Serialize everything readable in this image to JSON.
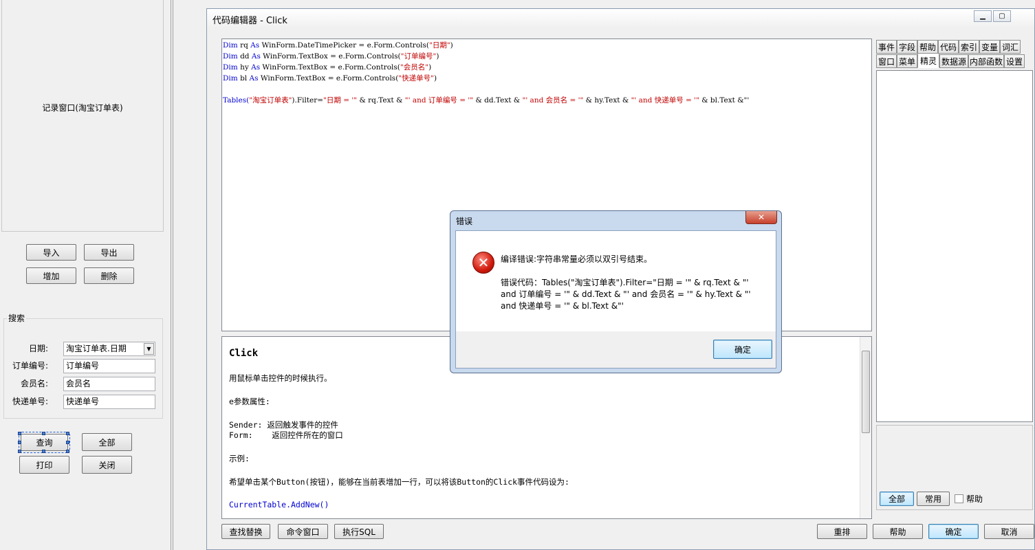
{
  "designer": {
    "record_window_label": "记录窗口(淘宝订单表)",
    "buttons": {
      "import": "导入",
      "export": "导出",
      "add": "增加",
      "delete": "删除",
      "query": "查询",
      "all": "全部",
      "print": "打印",
      "close": "关闭"
    },
    "search_group_label": "搜索",
    "fields": [
      {
        "label": "日期:",
        "value": "淘宝订单表.日期"
      },
      {
        "label": "订单编号:",
        "value": "订单编号"
      },
      {
        "label": "会员名:",
        "value": "会员名"
      },
      {
        "label": "快递单号:",
        "value": "快递单号"
      }
    ]
  },
  "editor": {
    "title": "代码编辑器 - Click",
    "code": {
      "l1": {
        "a": "Dim",
        "b": " rq ",
        "c": "As",
        "d": " WinForm.DateTimePicker = e.Form.Controls(",
        "e": "\"日期\"",
        "f": ")"
      },
      "l2": {
        "a": "Dim",
        "b": " dd ",
        "c": "As",
        "d": " WinForm.TextBox = e.Form.Controls(",
        "e": "\"订单编号\"",
        "f": ")"
      },
      "l3": {
        "a": "Dim",
        "b": " hy ",
        "c": "As",
        "d": " WinForm.TextBox = e.Form.Controls(",
        "e": "\"会员名\"",
        "f": ")"
      },
      "l4": {
        "a": "Dim",
        "b": " bl ",
        "c": "As",
        "d": " WinForm.TextBox = e.Form.Controls(",
        "e": "\"快递单号\"",
        "f": ")"
      },
      "l6": {
        "a": "Tables(",
        "b": "\"淘宝订单表\"",
        "c": ").Filter=",
        "d": "\"日期 = '\"",
        "e": " & rq.Text & ",
        "f": "\"' and 订单编号 = '\"",
        "g": " & dd.Text & ",
        "h": "\"' and 会员名 = '\"",
        "i": " & hy.Text & ",
        "j": "\"' and 快递单号 = '\"",
        "k": " & bl.Text &\"'"
      }
    },
    "help": {
      "title": "Click",
      "lines": [
        "用鼠标单击控件的时候执行。",
        "e参数属性:",
        "Sender: 返回触发事件的控件",
        "Form:    返回控件所在的窗口",
        "示例:",
        "希望单击某个Button(按钮)，能够在当前表增加一行，可以将该Button的Click事件代码设为:",
        "CurrentTable.AddNew()"
      ]
    },
    "tabs_row1": [
      "事件",
      "字段",
      "帮助",
      "代码",
      "索引",
      "变量",
      "词汇"
    ],
    "tabs_row2": [
      "窗口",
      "菜单",
      "精灵",
      "数据源",
      "内部函数",
      "设置"
    ],
    "side_buttons": {
      "all": "全部",
      "common": "常用",
      "help_checkbox": "帮助"
    },
    "bottom_buttons": {
      "find_replace": "查找替换",
      "command_window": "命令窗口",
      "exec_sql": "执行SQL",
      "rearrange": "重排",
      "help": "帮助",
      "ok": "确定",
      "cancel": "取消"
    }
  },
  "error_dialog": {
    "title": "错误",
    "message": "编译错误:字符串常量必须以双引号结束。",
    "code_line1": "错误代码：Tables(\"淘宝订单表\").Filter=\"日期 = '\" & rq.Text & \"'",
    "code_line2": "and 订单编号 = '\" & dd.Text & \"' and 会员名 = '\" & hy.Text & \"'",
    "code_line3": "and 快递单号 = '\" & bl.Text &\"'",
    "ok_button": "确定"
  }
}
